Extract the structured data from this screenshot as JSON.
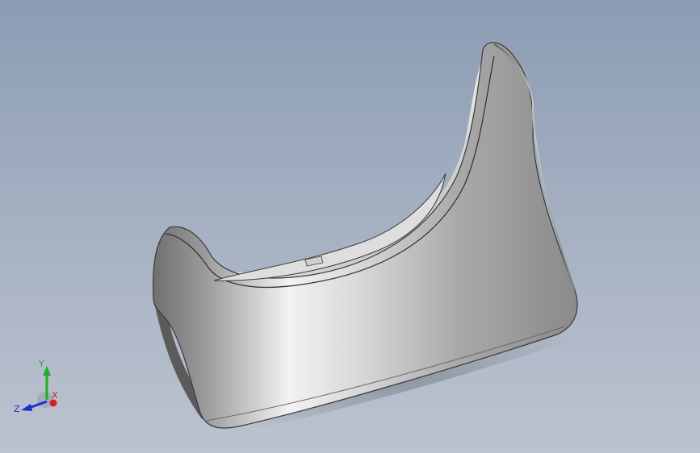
{
  "viewport": {
    "background_top": "#8c9cb3",
    "background_bottom": "#bcc3cf"
  },
  "triad": {
    "x_label": "X",
    "y_label": "Y",
    "z_label": "Z",
    "x_color": "#d62020",
    "y_color": "#1fae2a",
    "z_color": "#1a2fd0"
  }
}
